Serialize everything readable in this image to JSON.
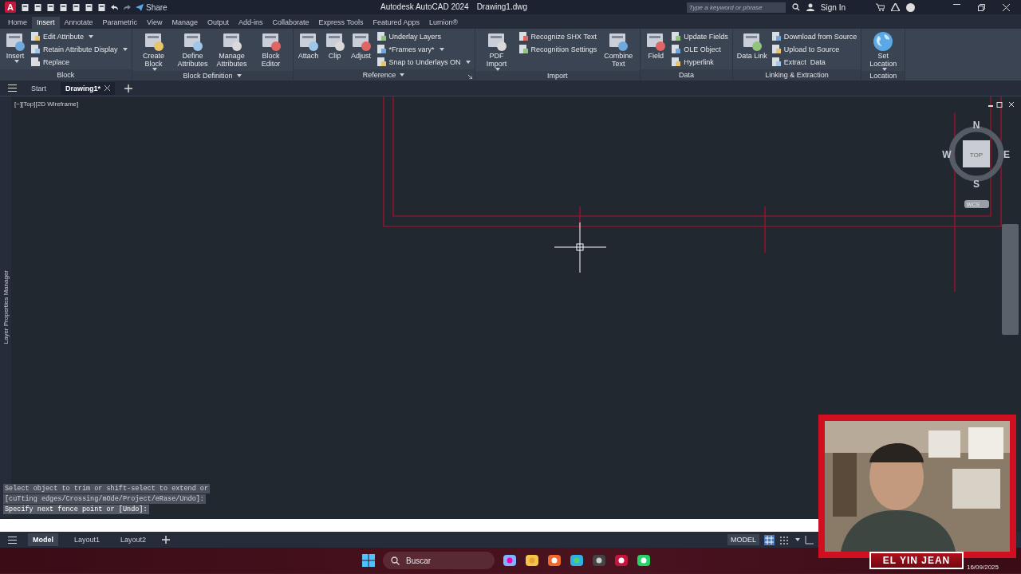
{
  "title_bar": {
    "app_letter": "A",
    "share": "Share",
    "title": "Autodesk AutoCAD 2024",
    "file": "Drawing1.dwg",
    "search_placeholder": "Type a keyword or phrase",
    "sign_in": "Sign In"
  },
  "ribbon_tabs": [
    {
      "label": "Home",
      "selected": false
    },
    {
      "label": "Insert",
      "selected": true
    },
    {
      "label": "Annotate",
      "selected": false
    },
    {
      "label": "Parametric",
      "selected": false
    },
    {
      "label": "View",
      "selected": false
    },
    {
      "label": "Manage",
      "selected": false
    },
    {
      "label": "Output",
      "selected": false
    },
    {
      "label": "Add-ins",
      "selected": false
    },
    {
      "label": "Collaborate",
      "selected": false
    },
    {
      "label": "Express Tools",
      "selected": false
    },
    {
      "label": "Featured Apps",
      "selected": false
    },
    {
      "label": "Lumion®",
      "selected": false
    }
  ],
  "ribbon_panels": [
    {
      "title": "Block",
      "menu": false,
      "launcher": false,
      "tools": [
        {
          "label": "Insert",
          "kind": "large",
          "dropdown": true
        },
        {
          "label": "Edit Attribute",
          "kind": "small",
          "dropdown": true
        },
        {
          "label": "Retain Attribute Display",
          "kind": "small",
          "dropdown": true
        },
        {
          "label": "Replace",
          "kind": "small",
          "dropdown": false
        }
      ]
    },
    {
      "title": "Block Definition",
      "menu": true,
      "launcher": false,
      "tools": [
        {
          "label": "Create Block",
          "kind": "large",
          "dropdown": true
        },
        {
          "label": "Define Attributes",
          "kind": "large",
          "dropdown": false
        },
        {
          "label": "Manage Attributes",
          "kind": "large",
          "dropdown": false
        },
        {
          "label": "Block Editor",
          "kind": "large",
          "dropdown": false
        }
      ]
    },
    {
      "title": "Reference",
      "menu": true,
      "launcher": true,
      "tools": [
        {
          "label": "Attach",
          "kind": "large",
          "dropdown": false
        },
        {
          "label": "Clip",
          "kind": "large",
          "dropdown": false
        },
        {
          "label": "Adjust",
          "kind": "large",
          "dropdown": false
        },
        {
          "label": "Underlay Layers",
          "kind": "small",
          "dropdown": false
        },
        {
          "label": "*Frames vary*",
          "kind": "small",
          "dropdown": true
        },
        {
          "label": "Snap to Underlays ON",
          "kind": "small",
          "dropdown": true
        }
      ]
    },
    {
      "title": "Import",
      "menu": false,
      "launcher": false,
      "tools": [
        {
          "label": "PDF Import",
          "kind": "large",
          "dropdown": true
        },
        {
          "label": "Recognize SHX Text",
          "kind": "small",
          "dropdown": false
        },
        {
          "label": "Recognition Settings",
          "kind": "small",
          "dropdown": false
        },
        {
          "label": "Combine Text",
          "kind": "large",
          "dropdown": false
        }
      ]
    },
    {
      "title": "Data",
      "menu": false,
      "launcher": false,
      "tools": [
        {
          "label": "Field",
          "kind": "large",
          "dropdown": false
        },
        {
          "label": "Update Fields",
          "kind": "small",
          "dropdown": false
        },
        {
          "label": "OLE Object",
          "kind": "small",
          "dropdown": false
        },
        {
          "label": "Hyperlink",
          "kind": "small",
          "dropdown": false
        }
      ]
    },
    {
      "title": "Linking & Extraction",
      "menu": false,
      "launcher": false,
      "tools": [
        {
          "label": "Data Link",
          "kind": "large",
          "dropdown": false
        },
        {
          "label": "Download from Source",
          "kind": "small",
          "dropdown": false
        },
        {
          "label": "Upload to Source",
          "kind": "small",
          "dropdown": false
        },
        {
          "label": "Extract  Data",
          "kind": "small",
          "dropdown": false
        }
      ]
    },
    {
      "title": "Location",
      "menu": false,
      "launcher": false,
      "tools": [
        {
          "label": "Set Location",
          "kind": "globe",
          "dropdown": true
        }
      ]
    }
  ],
  "file_tabs": [
    {
      "label": "Start",
      "selected": false,
      "closable": false
    },
    {
      "label": "Drawing1*",
      "selected": true,
      "closable": true
    }
  ],
  "viewport_label": "[−][Top][2D Wireframe]",
  "side_palette": "Layer Properties Manager",
  "viewcube": {
    "top": "TOP",
    "north": "N",
    "south": "S",
    "east": "E",
    "west": "W",
    "ucs": "WCS"
  },
  "command_history": [
    "Select object to trim or shift-select to extend or",
    "[cuTting edges/Crossing/mOde/Project/eRase/Undo]:",
    "Specify next fence point or [Undo]:"
  ],
  "layout_tabs": [
    {
      "label": "Model",
      "selected": true
    },
    {
      "label": "Layout1",
      "selected": false
    },
    {
      "label": "Layout2",
      "selected": false
    }
  ],
  "status_bar": {
    "mode": "MODEL"
  },
  "taskbar": {
    "search": "Buscar",
    "date": "16/09/2025"
  },
  "webcam": {
    "kind": "picture",
    "caption": "EL YIN JEAN"
  }
}
